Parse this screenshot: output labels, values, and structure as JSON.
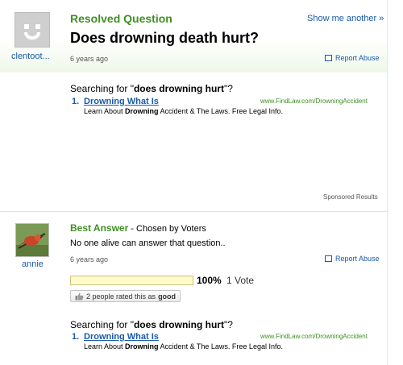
{
  "question": {
    "asker_name": "clentoot...",
    "status_label": "Resolved Question",
    "show_another": "Show me another »",
    "title": "Does drowning death hurt?",
    "time_ago": "6 years ago",
    "report_abuse": "Report Abuse"
  },
  "ad": {
    "searching_prefix": "Searching for \"",
    "searching_query": "does drowning hurt",
    "searching_suffix": "\"?",
    "number": "1.",
    "title": "Drowning What Is",
    "url": "www.FindLaw.com/DrowningAccident",
    "desc_pre": "Learn About ",
    "desc_bold": "Drowning",
    "desc_post": " Accident & The Laws. Free Legal Info."
  },
  "sponsored": "Sponsored Results",
  "answer": {
    "user_name": "annie",
    "best_label": "Best Answer",
    "chosen_by": " - Chosen by Voters",
    "text": "No one alive can answer that question..",
    "time_ago": "6 years ago",
    "report_abuse": "Report Abuse",
    "vote_percent": "100%",
    "vote_fraction": 1.0,
    "vote_count": "1 Vote",
    "rated_text": "2 people rated this as",
    "rated_bold": "good"
  },
  "icons": [
    "default-avatar-icon",
    "flag-icon",
    "thumbs-up-icon"
  ],
  "colors": {
    "green": "#3f8f24",
    "link": "#1a5aa8"
  }
}
